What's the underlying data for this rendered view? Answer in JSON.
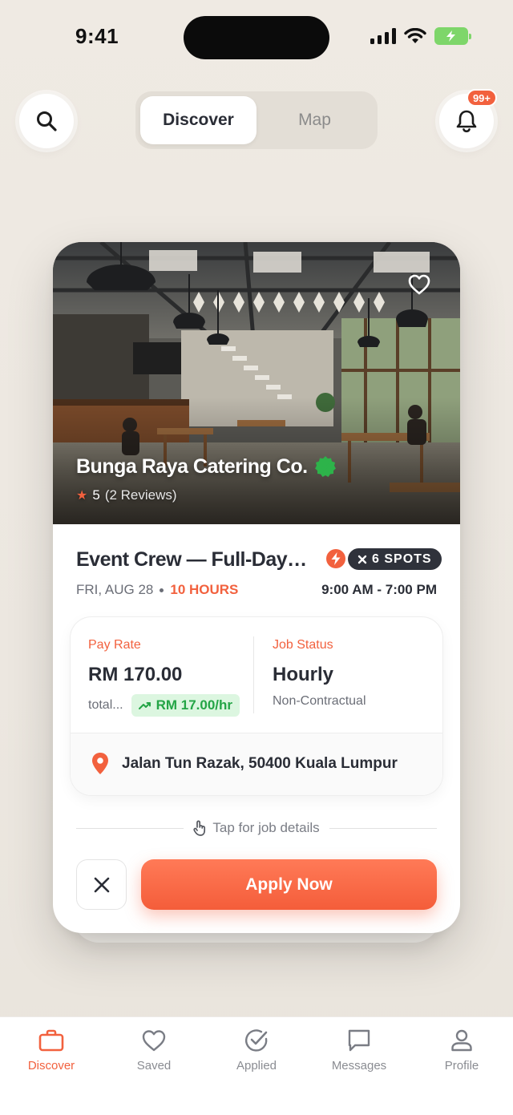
{
  "status_bar": {
    "time": "9:41"
  },
  "header": {
    "tabs": [
      {
        "label": "Discover",
        "active": true
      },
      {
        "label": "Map",
        "active": false
      }
    ],
    "notification_count": "99+"
  },
  "card": {
    "business_name": "Bunga Raya Catering Co.",
    "rating": "5",
    "reviews": "(2 Reviews)",
    "job_title": "Event Crew — Full-Day…",
    "spots": "6 SPOTS",
    "date": "FRI, AUG 28",
    "duration": "10 HOURS",
    "time_range": "9:00 AM - 7:00 PM",
    "pay": {
      "label": "Pay Rate",
      "amount": "RM 170.00",
      "total_label": "total...",
      "hourly": "RM 17.00/hr"
    },
    "status": {
      "label": "Job Status",
      "value": "Hourly",
      "contract": "Non-Contractual"
    },
    "location": "Jalan Tun Razak, 50400 Kuala Lumpur",
    "tap_hint": "Tap for job details",
    "apply_label": "Apply Now"
  },
  "bottom_nav": [
    {
      "label": "Discover",
      "icon": "briefcase-icon",
      "active": true
    },
    {
      "label": "Saved",
      "icon": "heart-icon",
      "active": false
    },
    {
      "label": "Applied",
      "icon": "check-circle-icon",
      "active": false
    },
    {
      "label": "Messages",
      "icon": "message-icon",
      "active": false
    },
    {
      "label": "Profile",
      "icon": "user-icon",
      "active": false
    }
  ],
  "colors": {
    "accent": "#f2613e",
    "success": "#24a546",
    "text": "#2a2d36",
    "background": "#efeae3"
  }
}
